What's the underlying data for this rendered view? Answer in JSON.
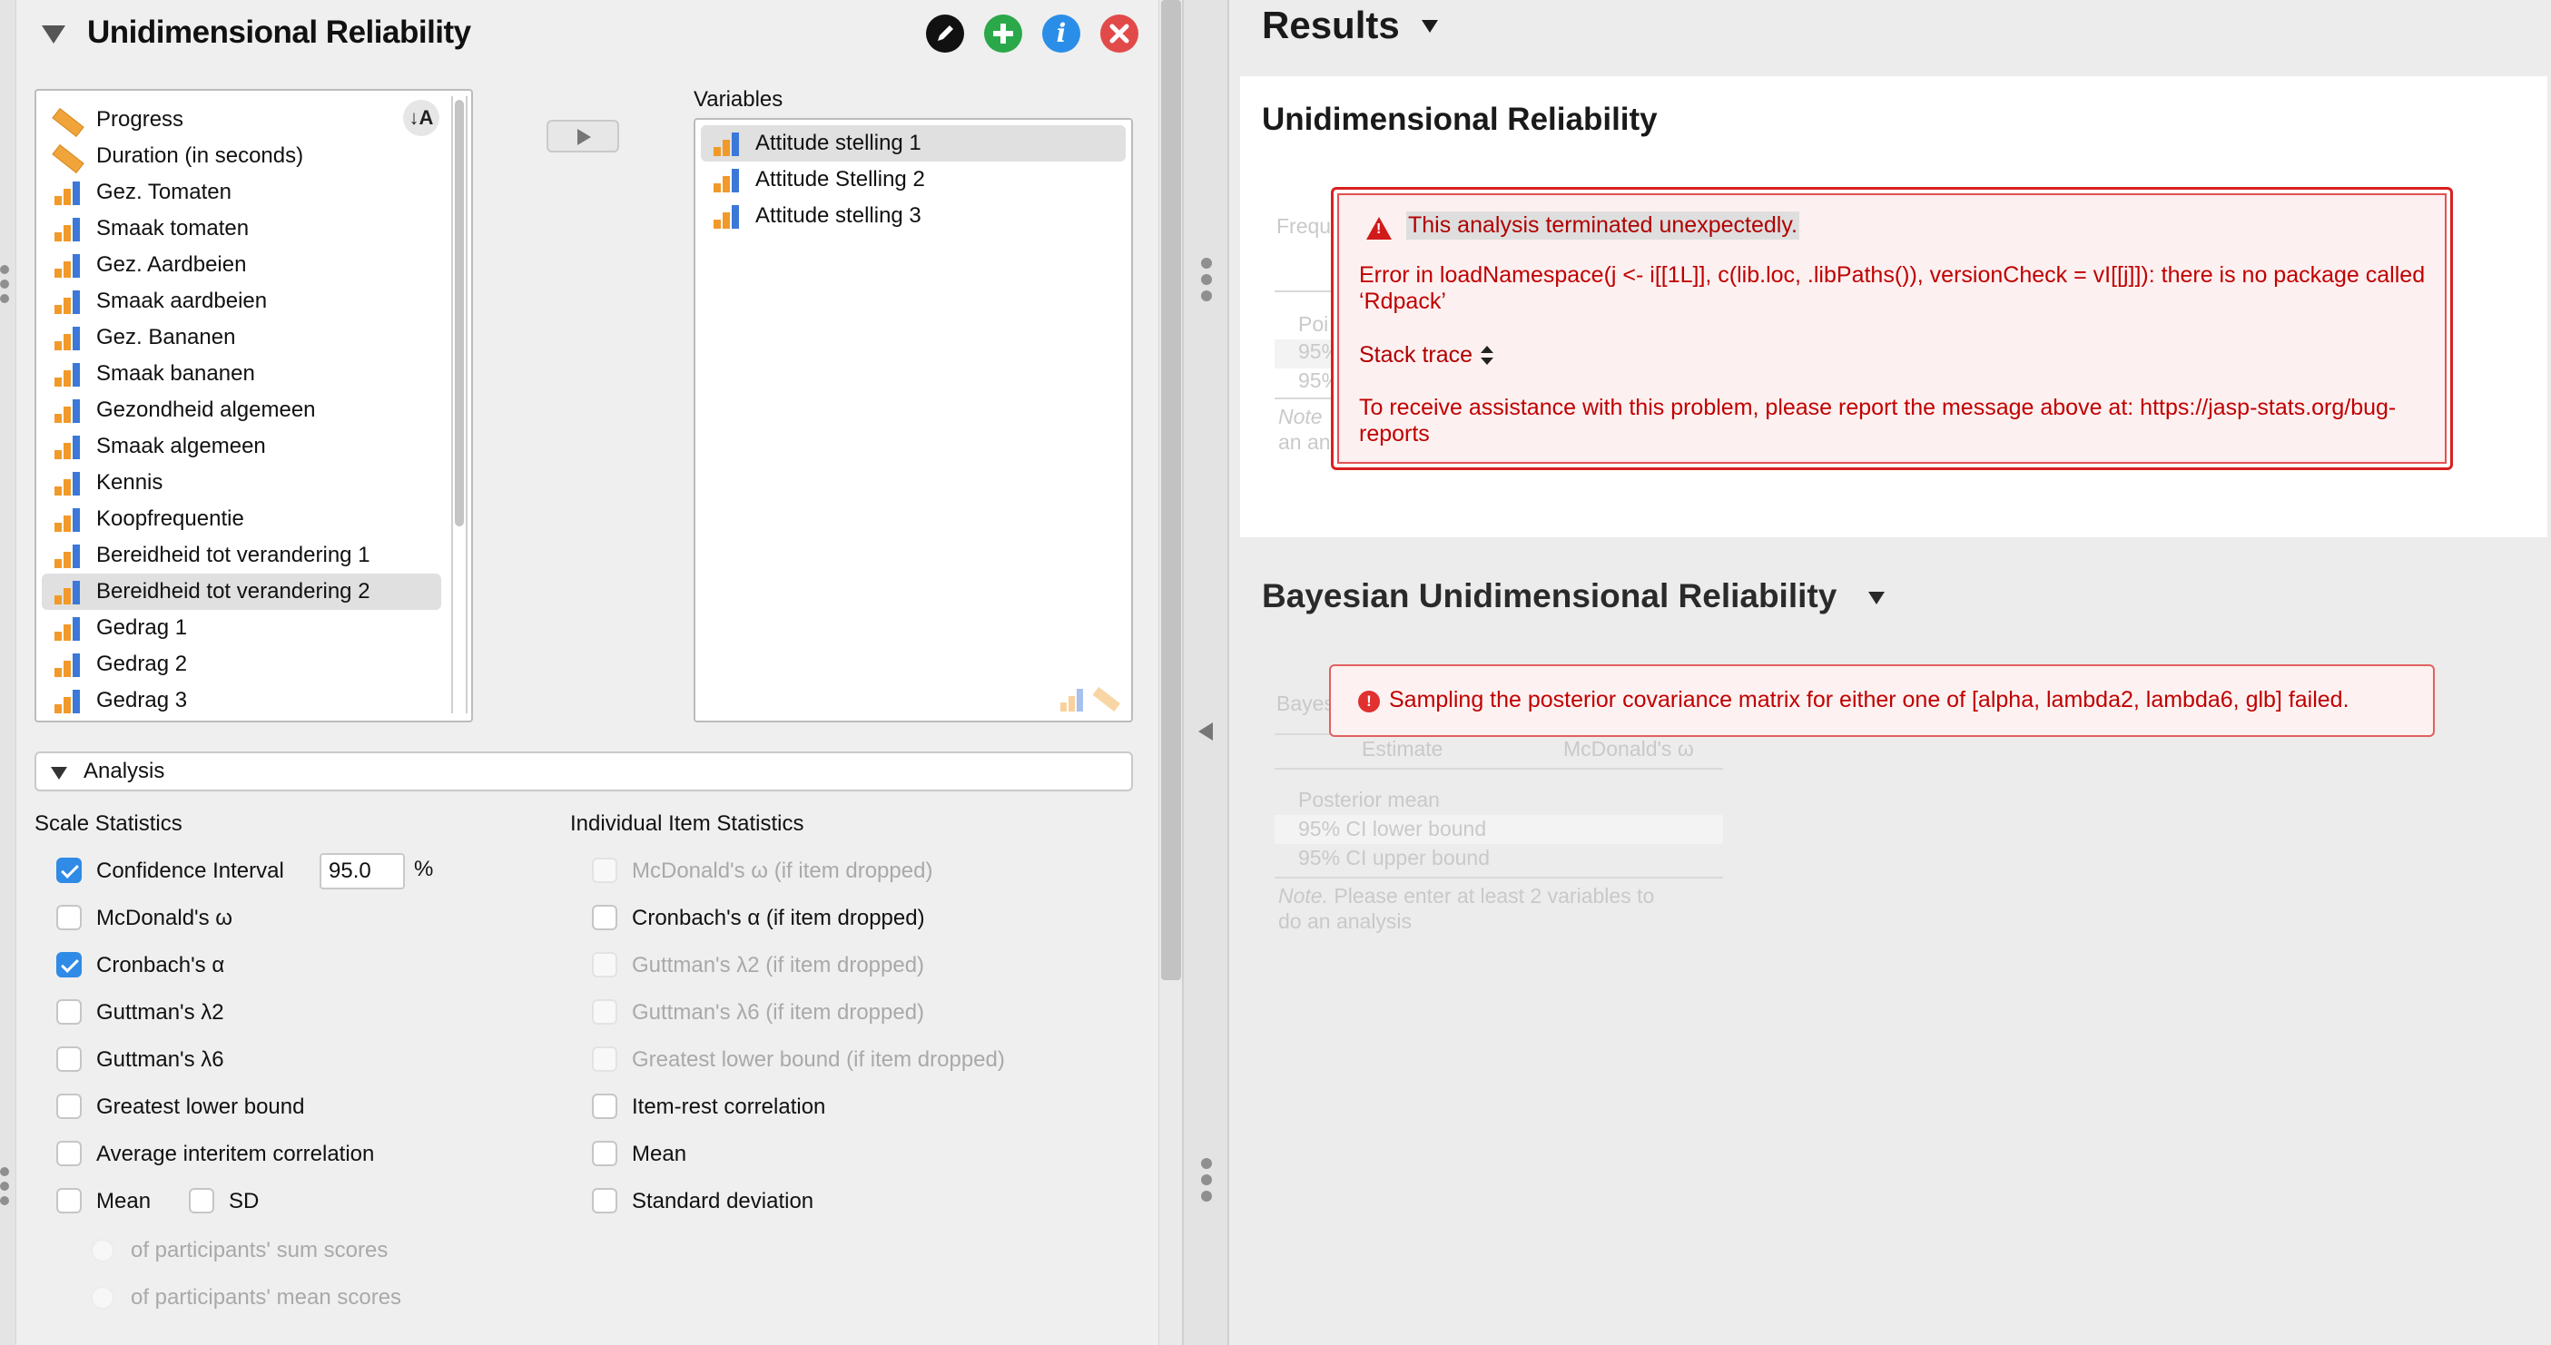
{
  "analysis_panel": {
    "title": "Unidimensional Reliability",
    "buttons": {
      "edit_icon": "pencil-icon",
      "add_icon": "plus-icon",
      "info_label": "i",
      "close_icon": "x-icon"
    },
    "sort_label": "↓A",
    "available_variables": [
      {
        "label": "Progress",
        "type": "scale"
      },
      {
        "label": "Duration (in seconds)",
        "type": "scale"
      },
      {
        "label": "Gez. Tomaten",
        "type": "ordinal"
      },
      {
        "label": "Smaak tomaten",
        "type": "ordinal"
      },
      {
        "label": "Gez. Aardbeien",
        "type": "ordinal"
      },
      {
        "label": "Smaak aardbeien",
        "type": "ordinal"
      },
      {
        "label": "Gez. Bananen",
        "type": "ordinal"
      },
      {
        "label": "Smaak bananen",
        "type": "ordinal"
      },
      {
        "label": "Gezondheid algemeen",
        "type": "ordinal"
      },
      {
        "label": "Smaak algemeen",
        "type": "ordinal"
      },
      {
        "label": "Kennis",
        "type": "ordinal"
      },
      {
        "label": "Koopfrequentie",
        "type": "ordinal"
      },
      {
        "label": "Bereidheid tot verandering 1",
        "type": "ordinal"
      },
      {
        "label": "Bereidheid tot verandering 2",
        "type": "ordinal",
        "selected": true
      },
      {
        "label": "Gedrag 1",
        "type": "ordinal"
      },
      {
        "label": "Gedrag 2",
        "type": "ordinal"
      },
      {
        "label": "Gedrag 3",
        "type": "ordinal"
      }
    ],
    "variables_label": "Variables",
    "selected_variables": [
      {
        "label": "Attitude stelling 1",
        "selected": true
      },
      {
        "label": "Attitude Stelling 2"
      },
      {
        "label": "Attitude stelling 3"
      }
    ],
    "analysis_section": "Analysis",
    "scale_statistics": {
      "title": "Scale Statistics",
      "confidence_interval": {
        "label": "Confidence Interval",
        "value": "95.0",
        "unit": "%",
        "checked": true
      },
      "mcdonald": {
        "label": "McDonald's ω",
        "checked": false
      },
      "cronbach": {
        "label": "Cronbach's α",
        "checked": true
      },
      "guttman2": {
        "label": "Guttman's λ2",
        "checked": false
      },
      "guttman6": {
        "label": "Guttman's λ6",
        "checked": false
      },
      "glb": {
        "label": "Greatest lower bound",
        "checked": false
      },
      "avg_interitem": {
        "label": "Average interitem correlation",
        "checked": false
      },
      "mean": {
        "label": "Mean",
        "checked": false
      },
      "sd": {
        "label": "SD",
        "checked": false
      },
      "sum_scores": "of participants' sum scores",
      "mean_scores": "of participants' mean scores"
    },
    "item_statistics": {
      "title": "Individual Item Statistics",
      "mcdonald_dropped": "McDonald's ω  (if item dropped)",
      "cronbach_dropped": "Cronbach's α (if item dropped)",
      "guttman2_dropped": "Guttman's λ2 (if item dropped)",
      "guttman6_dropped": "Guttman's λ6 (if item dropped)",
      "glb_dropped": "Greatest lower bound (if item dropped)",
      "item_rest": "Item-rest correlation",
      "mean": "Mean",
      "sd": "Standard deviation"
    }
  },
  "results": {
    "header": "Results",
    "unidimensional": {
      "title": "Unidimensional Reliability",
      "ghost_labels": [
        "Frequ",
        "Poi",
        "95%",
        "95%",
        "Note",
        "an an"
      ],
      "error": {
        "headline": "This analysis terminated unexpectedly.",
        "message": "Error in loadNamespace(j <- i[[1L]], c(lib.loc, .libPaths()), versionCheck = vI[[j]]): there is no package called ‘Rdpack’",
        "stack_trace": "Stack trace",
        "report": "To receive assistance with this problem, please report the message above at: https://jasp-stats.org/bug-reports"
      }
    },
    "bayesian": {
      "title": "Bayesian Unidimensional Reliability",
      "ghost_table": {
        "caption": "Bayes",
        "col_estimate": "Estimate",
        "col_omega": "McDonald's ω",
        "rows": [
          "Posterior mean",
          "95% CI lower bound",
          "95% CI upper bound"
        ],
        "note_label": "Note.",
        "note_text": " Please enter at least 2 variables to",
        "note_text2": "do an analysis"
      },
      "error": "Sampling the posterior covariance matrix for either one of [alpha, lambda2, lambda6, glb] failed."
    }
  },
  "colors": {
    "accent_blue": "#2f8be6",
    "error_red": "#c00000",
    "add_green": "#2aa84a",
    "info_blue": "#2a8ee8",
    "close_red": "#e24a4a"
  }
}
